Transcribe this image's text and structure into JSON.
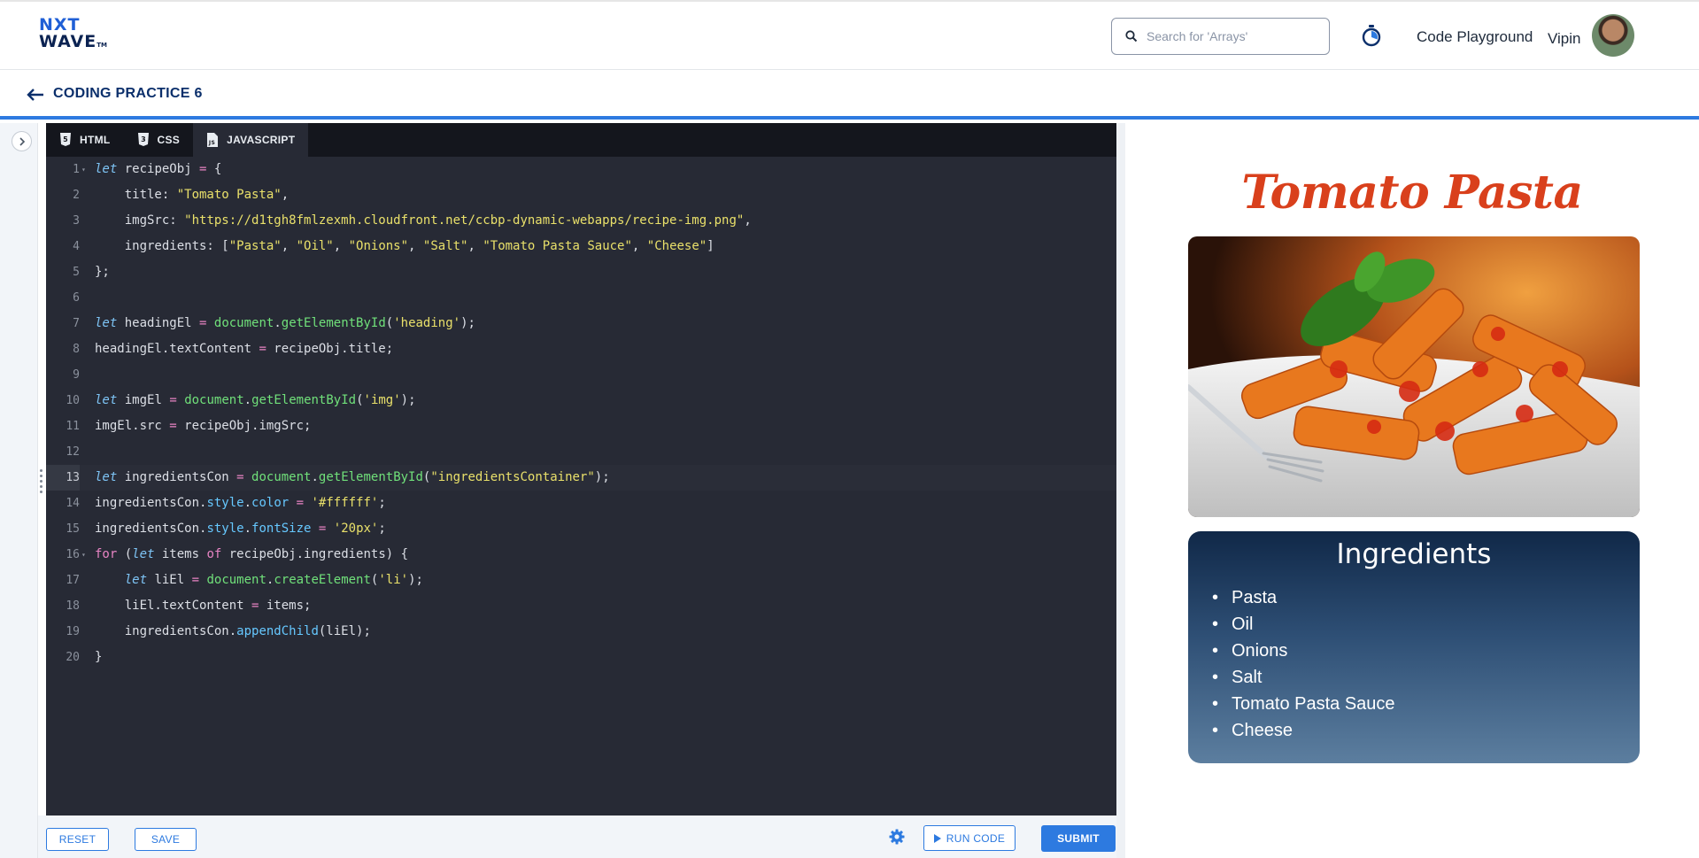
{
  "header": {
    "logo_line1": "NXT",
    "logo_line2": "WAVE",
    "logo_tm": "TM",
    "search_placeholder": "Search for 'Arrays'",
    "code_playground_label": "Code Playground",
    "user_name": "Vipin"
  },
  "subheader": {
    "title": "CODING PRACTICE 6"
  },
  "editor": {
    "tabs": [
      {
        "label": "HTML",
        "icon": "html5-icon"
      },
      {
        "label": "CSS",
        "icon": "css3-icon"
      },
      {
        "label": "JAVASCRIPT",
        "icon": "js-file-icon",
        "active": true
      }
    ],
    "current_line": 13,
    "line_numbers": [
      "1",
      "2",
      "3",
      "4",
      "5",
      "6",
      "7",
      "8",
      "9",
      "10",
      "11",
      "12",
      "13",
      "14",
      "15",
      "16",
      "17",
      "18",
      "19",
      "20"
    ],
    "code_lines": [
      "let recipeObj = {",
      "    title: \"Tomato Pasta\",",
      "    imgSrc: \"https://d1tgh8fmlzexmh.cloudfront.net/ccbp-dynamic-webapps/recipe-img.png\",",
      "    ingredients: [\"Pasta\", \"Oil\", \"Onions\", \"Salt\", \"Tomato Pasta Sauce\", \"Cheese\"]",
      "};",
      "",
      "let headingEl = document.getElementById('heading');",
      "headingEl.textContent = recipeObj.title;",
      "",
      "let imgEl = document.getElementById('img');",
      "imgEl.src = recipeObj.imgSrc;",
      "",
      "let ingredientsCon = document.getElementById(\"ingredientsContainer\");",
      "ingredientsCon.style.color = '#ffffff';",
      "ingredientsCon.style.fontSize = '20px';",
      "for (let items of recipeObj.ingredients) {",
      "    let liEl = document.createElement('li');",
      "    liEl.textContent = items;",
      "    ingredientsCon.appendChild(liEl);",
      "}"
    ]
  },
  "toolbar": {
    "reset_label": "RESET",
    "save_label": "SAVE",
    "run_label": "RUN CODE",
    "submit_label": "SUBMIT"
  },
  "preview": {
    "title": "Tomato Pasta",
    "ingredients_heading": "Ingredients",
    "ingredients": [
      "Pasta",
      "Oil",
      "Onions",
      "Salt",
      "Tomato Pasta Sauce",
      "Cheese"
    ]
  },
  "colors": {
    "accent": "#2d7ae0",
    "title_red": "#d9401c",
    "editor_bg": "#272a35"
  }
}
